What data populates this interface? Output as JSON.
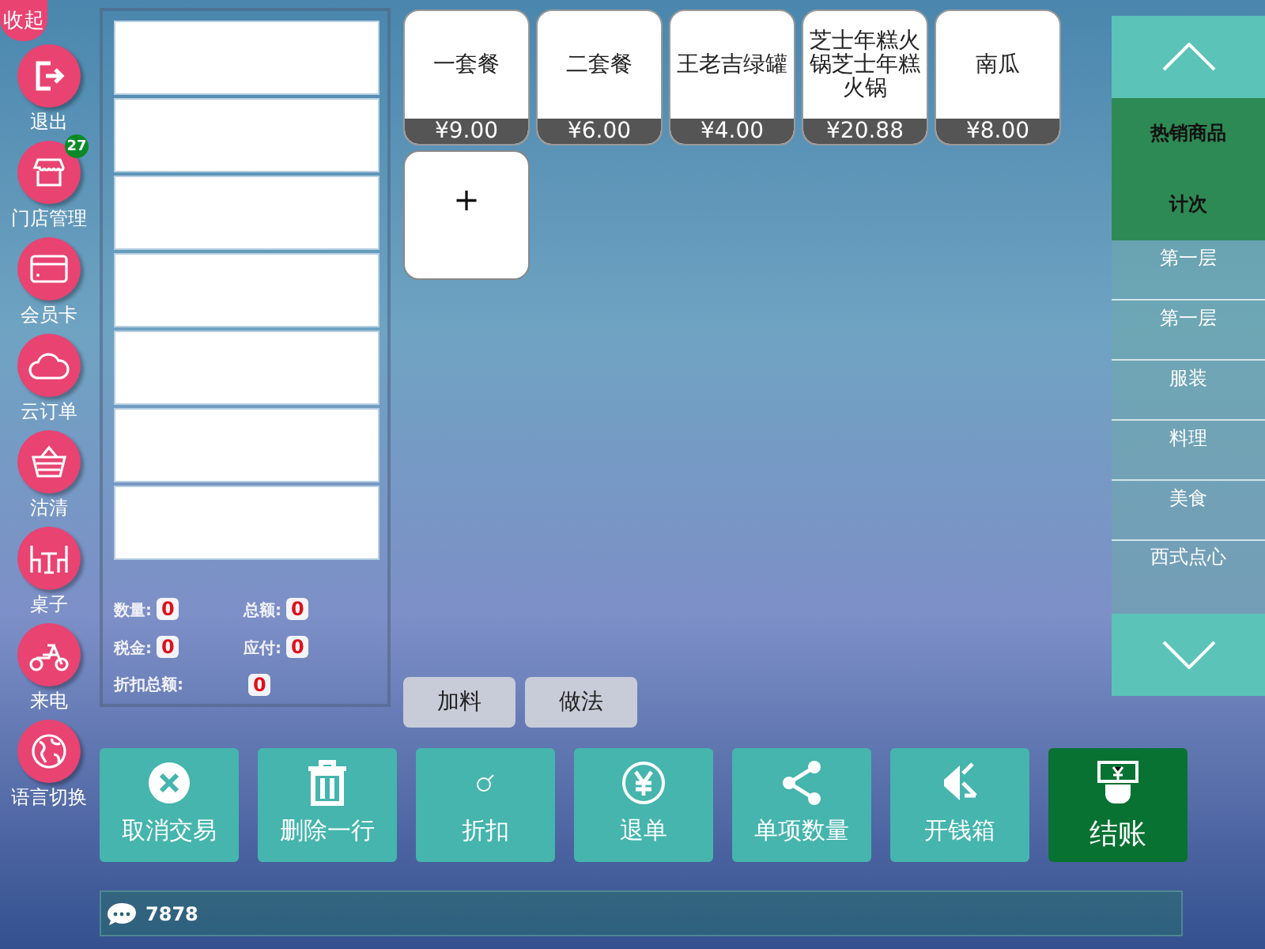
{
  "sidebar": {
    "collapse_label": "收起",
    "items": [
      {
        "kind": "exit",
        "label": "退出"
      },
      {
        "kind": "store",
        "label": "门店管理",
        "badge": "27"
      },
      {
        "kind": "card",
        "label": "会员卡"
      },
      {
        "kind": "cloud",
        "label": "云订单"
      },
      {
        "kind": "basket",
        "label": "沽清"
      },
      {
        "kind": "table",
        "label": "桌子"
      },
      {
        "kind": "scooter",
        "label": "来电"
      },
      {
        "kind": "globe",
        "label": "语言切换"
      }
    ]
  },
  "order": {
    "summary": [
      {
        "label": "数量:",
        "value": "0"
      },
      {
        "label": "总额:",
        "value": "0"
      },
      {
        "label": "税金:",
        "value": "0"
      },
      {
        "label": "应付:",
        "value": "0"
      },
      {
        "label": "折扣总额:",
        "value": "0",
        "kind": "wide"
      }
    ]
  },
  "products": [
    {
      "name": "一套餐",
      "price": "¥9.00"
    },
    {
      "name": "二套餐",
      "price": "¥6.00"
    },
    {
      "name": "王老吉绿罐",
      "price": "¥4.00"
    },
    {
      "name": "芝士年糕火锅芝士年糕火锅",
      "price": "¥20.88"
    },
    {
      "name": "南瓜",
      "price": "¥8.00"
    }
  ],
  "add_tile": "+",
  "modifiers": [
    "加料",
    "做法"
  ],
  "categories": [
    {
      "label": "热销商品",
      "selected": true
    },
    {
      "label": "计次",
      "selected": true
    },
    {
      "label": "第一层",
      "selected": false
    },
    {
      "label": "第一层",
      "selected": false
    },
    {
      "label": "服装",
      "selected": false
    },
    {
      "label": "料理",
      "selected": false
    },
    {
      "label": "美食",
      "selected": false
    },
    {
      "label": "西式点心",
      "selected": false
    }
  ],
  "actions": [
    {
      "kind": "cancel",
      "label": "取消交易"
    },
    {
      "kind": "trash",
      "label": "删除一行"
    },
    {
      "kind": "tag",
      "label": "折扣"
    },
    {
      "kind": "yen",
      "label": "退单"
    },
    {
      "kind": "share",
      "label": "单项数量"
    },
    {
      "kind": "drawer",
      "label": "开钱箱"
    },
    {
      "kind": "pay",
      "label": "结账"
    }
  ],
  "status_bar": {
    "text": "7878"
  }
}
